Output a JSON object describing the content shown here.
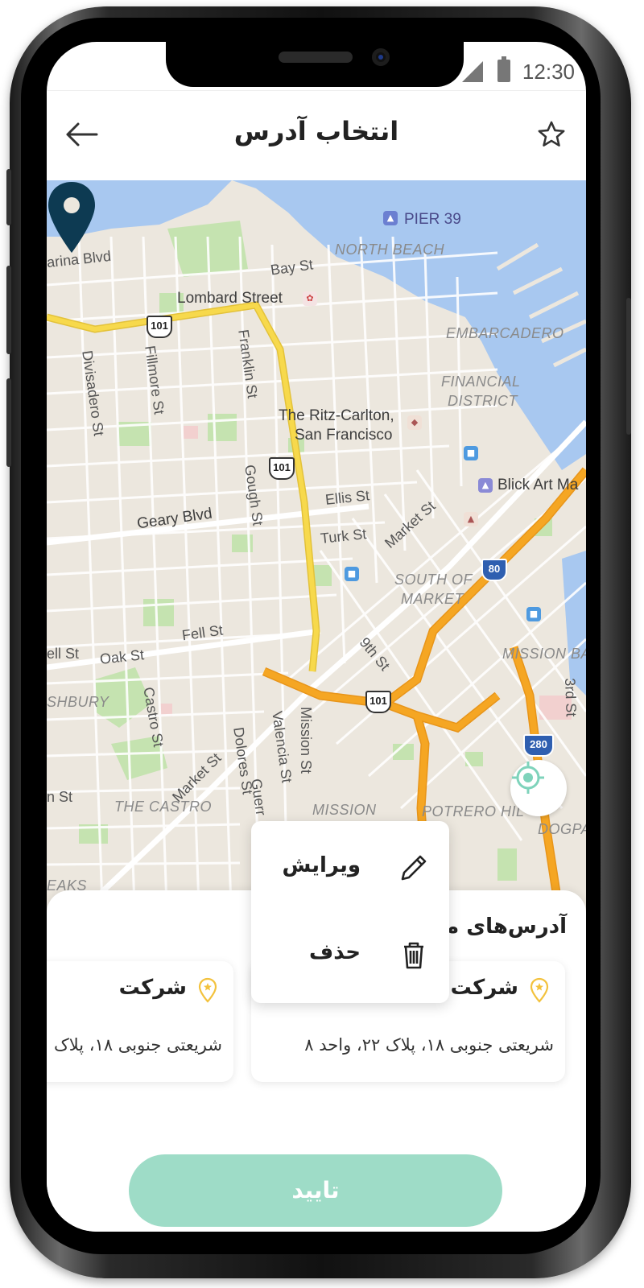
{
  "status_bar": {
    "time": "12:30",
    "signal": "signal-icon",
    "battery": "battery-icon"
  },
  "header": {
    "title": "انتخاب آدرس",
    "back_icon": "arrow-left-icon",
    "favorite_icon": "star-icon"
  },
  "map": {
    "labels": {
      "pier39": "PIER 39",
      "north_beach": "NORTH BEACH",
      "marina_blvd": "arina Blvd",
      "bay_st": "Bay St",
      "lombard": "Lombard Street",
      "embarcadero": "EMBARCADERO",
      "financial": "FINANCIAL",
      "district": "DISTRICT",
      "divisadero": "Divisadero St",
      "fillmore": "Fillmore St",
      "franklin": "Franklin St",
      "ritz1": "The Ritz-Carlton,",
      "ritz2": "San Francisco",
      "blick": "Blick Art Ma",
      "gough": "Gough St",
      "ellis": "Ellis St",
      "turk": "Turk St",
      "market1": "Market St",
      "geary": "Geary Blvd",
      "south_of1": "SOUTH OF",
      "south_of2": "MARKET",
      "fell": "Fell St",
      "oak": "Oak St",
      "ell": "ell St",
      "ninth": "9th St",
      "mission_bay": "MISSION BA",
      "shbury": "SHBURY",
      "castro_st": "Castro St",
      "market2": "Market St",
      "dolores": "Dolores St",
      "valencia": "Valencia St",
      "mission_st": "Mission St",
      "third": "3rd St",
      "the_castro": "THE CASTRO",
      "mission": "MISSION",
      "potrero": "POTRERO HIL",
      "dogpa": "DOGPA",
      "n_st": "n St",
      "guerr": "Guerr",
      "eaks": "EAKS"
    },
    "shields": {
      "s101a": "101",
      "s101b": "101",
      "s101c": "101",
      "s80": "80",
      "s280": "280"
    },
    "locate_icon": "crosshair-icon",
    "pin_icon": "location-pin-icon"
  },
  "sheet": {
    "title": "آدرس‌های منت",
    "cards": [
      {
        "name": "شرکت",
        "address": "شریعتی جنوبی ۱۸، پلاک ۲۲، واحد ۸"
      },
      {
        "name": "شرکت",
        "address": "شریعتی جنوبی ۱۸، پلاک"
      }
    ],
    "confirm_label": "تایید"
  },
  "context_menu": {
    "edit_label": "ویرایش",
    "delete_label": "حذف",
    "edit_icon": "pencil-icon",
    "delete_icon": "trash-icon"
  },
  "colors": {
    "accent": "#9edcc7",
    "pin": "#0d3a52",
    "highway": "#f5a623",
    "primary_road": "#f7d94c",
    "water": "#a8c8f0",
    "park": "#c5e3b0",
    "land": "#ece7de"
  }
}
